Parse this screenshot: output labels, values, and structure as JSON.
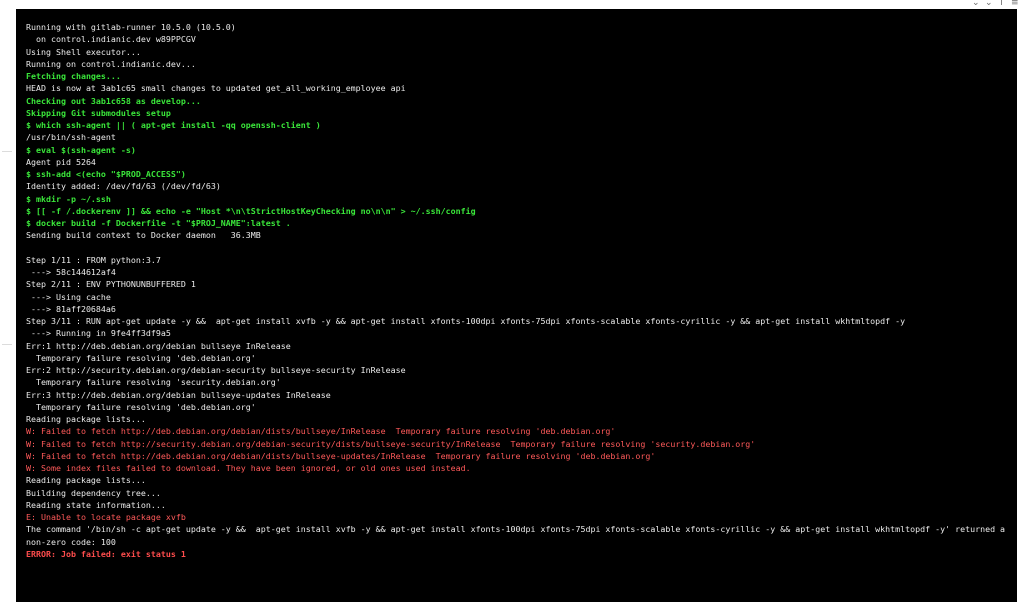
{
  "log_lines": [
    {
      "text": "Running with gitlab-runner 10.5.0 (10.5.0)",
      "style": "plain"
    },
    {
      "text": "  on control.indianic.dev w89PPCGV",
      "style": "plain"
    },
    {
      "text": "Using Shell executor...",
      "style": "plain"
    },
    {
      "text": "Running on control.indianic.dev...",
      "style": "plain"
    },
    {
      "text": "Fetching changes...",
      "style": "green"
    },
    {
      "text": "HEAD is now at 3ab1c65 small changes to updated get_all_working_employee api",
      "style": "plain"
    },
    {
      "text": "Checking out 3ab1c658 as develop...",
      "style": "green"
    },
    {
      "text": "Skipping Git submodules setup",
      "style": "green"
    },
    {
      "text": "$ which ssh-agent || ( apt-get install -qq openssh-client )",
      "style": "green"
    },
    {
      "text": "/usr/bin/ssh-agent",
      "style": "plain"
    },
    {
      "text": "$ eval $(ssh-agent -s)",
      "style": "green"
    },
    {
      "text": "Agent pid 5264",
      "style": "plain"
    },
    {
      "text": "$ ssh-add <(echo \"$PROD_ACCESS\")",
      "style": "green"
    },
    {
      "text": "Identity added: /dev/fd/63 (/dev/fd/63)",
      "style": "plain"
    },
    {
      "text": "$ mkdir -p ~/.ssh",
      "style": "green"
    },
    {
      "text": "$ [[ -f /.dockerenv ]] && echo -e \"Host *\\n\\tStrictHostKeyChecking no\\n\\n\" > ~/.ssh/config",
      "style": "green"
    },
    {
      "text": "$ docker build -f Dockerfile -t \"$PROJ_NAME\":latest .",
      "style": "green"
    },
    {
      "text": "Sending build context to Docker daemon   36.3MB",
      "style": "plain"
    },
    {
      "text": "",
      "style": "plain"
    },
    {
      "text": "Step 1/11 : FROM python:3.7",
      "style": "plain"
    },
    {
      "text": " ---> 58c144612af4",
      "style": "plain"
    },
    {
      "text": "Step 2/11 : ENV PYTHONUNBUFFERED 1",
      "style": "plain"
    },
    {
      "text": " ---> Using cache",
      "style": "plain"
    },
    {
      "text": " ---> 81aff20684a6",
      "style": "plain"
    },
    {
      "text": "Step 3/11 : RUN apt-get update -y &&  apt-get install xvfb -y && apt-get install xfonts-100dpi xfonts-75dpi xfonts-scalable xfonts-cyrillic -y && apt-get install wkhtmltopdf -y",
      "style": "plain"
    },
    {
      "text": " ---> Running in 9fe4ff3df9a5",
      "style": "plain"
    },
    {
      "text": "Err:1 http://deb.debian.org/debian bullseye InRelease",
      "style": "plain"
    },
    {
      "text": "  Temporary failure resolving 'deb.debian.org'",
      "style": "plain"
    },
    {
      "text": "Err:2 http://security.debian.org/debian-security bullseye-security InRelease",
      "style": "plain"
    },
    {
      "text": "  Temporary failure resolving 'security.debian.org'",
      "style": "plain"
    },
    {
      "text": "Err:3 http://deb.debian.org/debian bullseye-updates InRelease",
      "style": "plain"
    },
    {
      "text": "  Temporary failure resolving 'deb.debian.org'",
      "style": "plain"
    },
    {
      "text": "Reading package lists...",
      "style": "plain"
    },
    {
      "text": "W: Failed to fetch http://deb.debian.org/debian/dists/bullseye/InRelease  Temporary failure resolving 'deb.debian.org'",
      "style": "red"
    },
    {
      "text": "W: Failed to fetch http://security.debian.org/debian-security/dists/bullseye-security/InRelease  Temporary failure resolving 'security.debian.org'",
      "style": "red"
    },
    {
      "text": "W: Failed to fetch http://deb.debian.org/debian/dists/bullseye-updates/InRelease  Temporary failure resolving 'deb.debian.org'",
      "style": "red"
    },
    {
      "text": "W: Some index files failed to download. They have been ignored, or old ones used instead.",
      "style": "red"
    },
    {
      "text": "Reading package lists...",
      "style": "plain"
    },
    {
      "text": "Building dependency tree...",
      "style": "plain"
    },
    {
      "text": "Reading state information...",
      "style": "plain"
    },
    {
      "text": "E: Unable to locate package xvfb",
      "style": "red"
    },
    {
      "text": "The command '/bin/sh -c apt-get update -y &&  apt-get install xvfb -y && apt-get install xfonts-100dpi xfonts-75dpi xfonts-scalable xfonts-cyrillic -y && apt-get install wkhtmltopdf -y' returned a",
      "style": "plain"
    },
    {
      "text": "non-zero code: 100",
      "style": "plain"
    },
    {
      "text": "ERROR: Job failed: exit status 1",
      "style": "redb"
    }
  ],
  "colors": {
    "background": "#000000",
    "plain": "#ececec",
    "green": "#3ae63a",
    "red": "#ff5a5a"
  },
  "top_icons": [
    "chevron-icon",
    "chevron-icon",
    "info-icon",
    "menu-icon"
  ]
}
